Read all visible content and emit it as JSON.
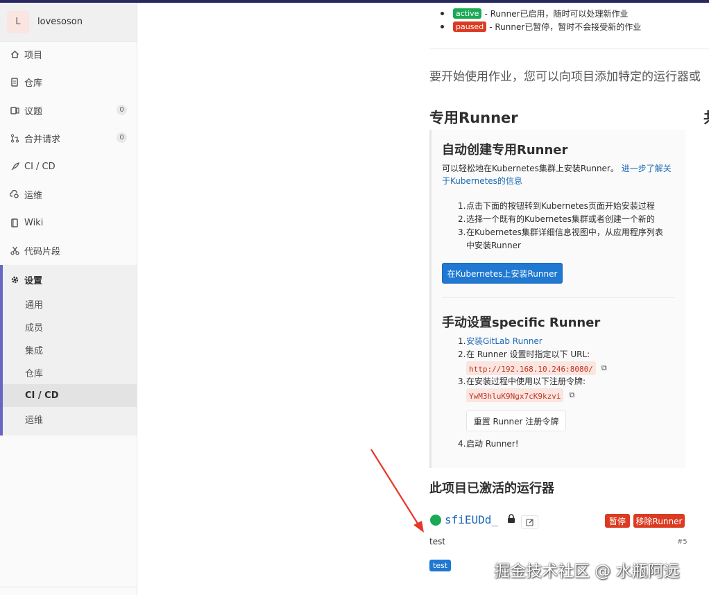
{
  "sidebar": {
    "avatar_letter": "L",
    "project_name": "lovesoson",
    "items": [
      {
        "label": "项目",
        "icon": "home-icon"
      },
      {
        "label": "仓库",
        "icon": "doc-icon"
      },
      {
        "label": "议题",
        "icon": "issues-icon",
        "count": "0"
      },
      {
        "label": "合并请求",
        "icon": "merge-request-icon",
        "count": "0"
      },
      {
        "label": "CI / CD",
        "icon": "rocket-icon"
      },
      {
        "label": "运维",
        "icon": "cloud-gear-icon"
      },
      {
        "label": "Wiki",
        "icon": "book-icon"
      },
      {
        "label": "代码片段",
        "icon": "scissors-icon"
      }
    ],
    "settings": {
      "label": "设置",
      "icon": "gear-icon",
      "sub_items": [
        "通用",
        "成员",
        "集成",
        "仓库",
        "CI / CD",
        "运维"
      ],
      "active_sub": "CI / CD"
    }
  },
  "status_legend": [
    {
      "badge": "active",
      "text": "- Runner已启用，随时可以处理新作业"
    },
    {
      "badge": "paused",
      "text": "- Runner已暂停，暂时不会接受新的作业"
    }
  ],
  "intro_text": "要开始使用作业，您可以向项目添加特定的运行器或",
  "specific_heading": "专用Runner",
  "right_heading_cut": "共",
  "auto": {
    "heading": "自动创建专用Runner",
    "desc": "可以轻松地在Kubernetes集群上安装Runner。",
    "link": "进一步了解关于Kubernetes的信息",
    "steps": [
      "点击下面的按钮转到Kubernetes页面开始安装过程",
      "选择一个既有的Kubernetes集群或者创建一个新的",
      "在Kubernetes集群详细信息视图中，从应用程序列表中安装Runner"
    ],
    "button": "在Kubernetes上安装Runner"
  },
  "manual": {
    "heading": "手动设置specific Runner",
    "step1_link": "安装GitLab Runner",
    "step2": "在 Runner 设置时指定以下 URL:",
    "url": "http://192.168.10.246:8080/",
    "step3": "在安装过程中使用以下注册令牌:",
    "token": "YwM3hluK9Ngx7cK9kzvi",
    "reset_button": "重置 Runner 注册令牌",
    "step4": "启动 Runner!"
  },
  "activated": {
    "heading": "此项目已激活的运行器",
    "runner_name": "sfiEUDd_",
    "pause_button": "暂停",
    "remove_button": "移除Runner",
    "description": "test",
    "runner_id": "#5",
    "tag": "test"
  },
  "watermark": "掘金技术社区 @ 水瓶阿远",
  "colors": {
    "topbar": "#292961",
    "active": "#1aaa55",
    "paused": "#db3b21",
    "primary": "#1f78d1",
    "link": "#1b69b6",
    "settings_accent": "#6666c4",
    "arrow": "#e8372a"
  }
}
